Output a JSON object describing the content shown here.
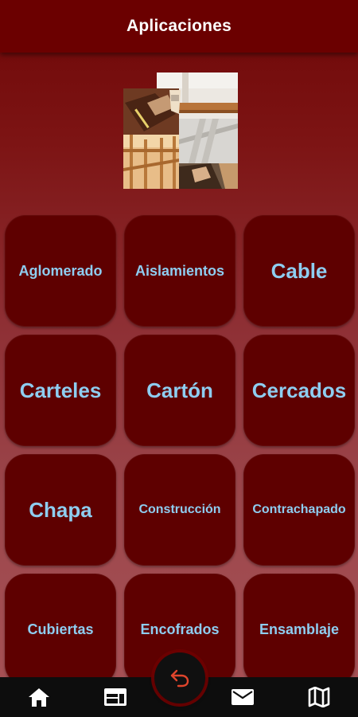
{
  "app_bar": {
    "title": "Aplicaciones"
  },
  "colors": {
    "app_bar_bg": "#6b0000",
    "tile_bg": "#5e0000",
    "tile_text": "#8ecdf0",
    "nav_bg": "#0d0d0d",
    "fab_icon": "#e0452c"
  },
  "banner": {
    "image": "collage-of-construction-photos"
  },
  "tiles": [
    {
      "label": "Aglomerado"
    },
    {
      "label": "Aislamientos"
    },
    {
      "label": "Cable"
    },
    {
      "label": "Carteles"
    },
    {
      "label": "Cartón"
    },
    {
      "label": "Cercados"
    },
    {
      "label": "Chapa"
    },
    {
      "label": "Construcción"
    },
    {
      "label": "Contrachapado"
    },
    {
      "label": "Cubiertas"
    },
    {
      "label": "Encofrados"
    },
    {
      "label": "Ensamblaje"
    }
  ],
  "bottom_nav": [
    {
      "icon": "home-icon"
    },
    {
      "icon": "web-icon"
    },
    {
      "icon": "back-icon"
    },
    {
      "icon": "mail-icon"
    },
    {
      "icon": "map-icon"
    }
  ]
}
